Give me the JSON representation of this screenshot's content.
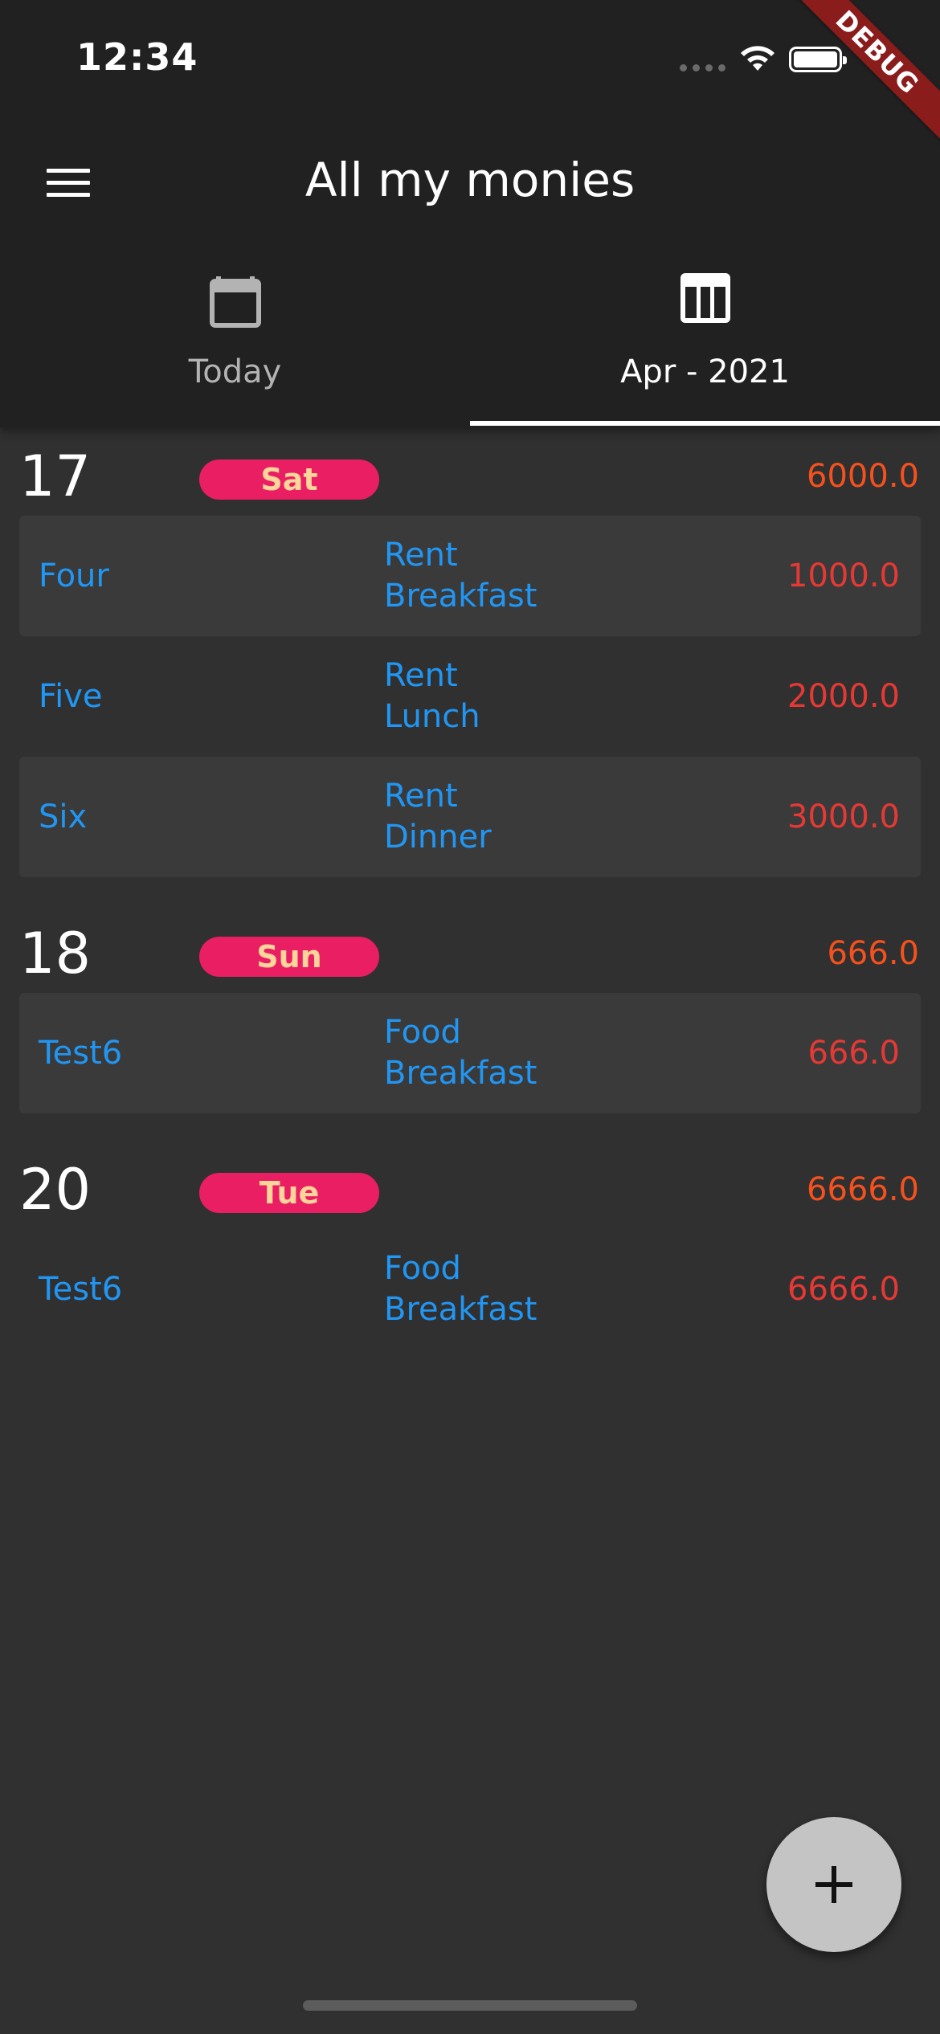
{
  "status_bar": {
    "time": "12:34",
    "debug_label": "DEBUG"
  },
  "app_bar": {
    "title": "All my monies"
  },
  "tabs": [
    {
      "label": "Today",
      "icon": "calendar-icon",
      "selected": false
    },
    {
      "label": "Apr - 2021",
      "icon": "table-icon",
      "selected": true
    }
  ],
  "days": [
    {
      "day": "17",
      "weekday": "Sat",
      "total": "6000.0",
      "entries": [
        {
          "name": "Four",
          "category": "Rent",
          "subcategory": "Breakfast",
          "amount": "1000.0"
        },
        {
          "name": "Five",
          "category": "Rent",
          "subcategory": "Lunch",
          "amount": "2000.0"
        },
        {
          "name": "Six",
          "category": "Rent",
          "subcategory": "Dinner",
          "amount": "3000.0"
        }
      ]
    },
    {
      "day": "18",
      "weekday": "Sun",
      "total": "666.0",
      "entries": [
        {
          "name": "Test6",
          "category": "Food",
          "subcategory": "Breakfast",
          "amount": "666.0"
        }
      ]
    },
    {
      "day": "20",
      "weekday": "Tue",
      "total": "6666.0",
      "entries": [
        {
          "name": "Test6",
          "category": "Food",
          "subcategory": "Breakfast",
          "amount": "6666.0"
        }
      ]
    }
  ],
  "fab": {
    "icon": "plus-icon"
  },
  "colors": {
    "background": "#303030",
    "app_bar": "#212121",
    "badge": "#e91e63",
    "badge_text": "#ffd59a",
    "entry_text": "#2196f3",
    "amount": "#e53935",
    "total": "#f4511e"
  }
}
